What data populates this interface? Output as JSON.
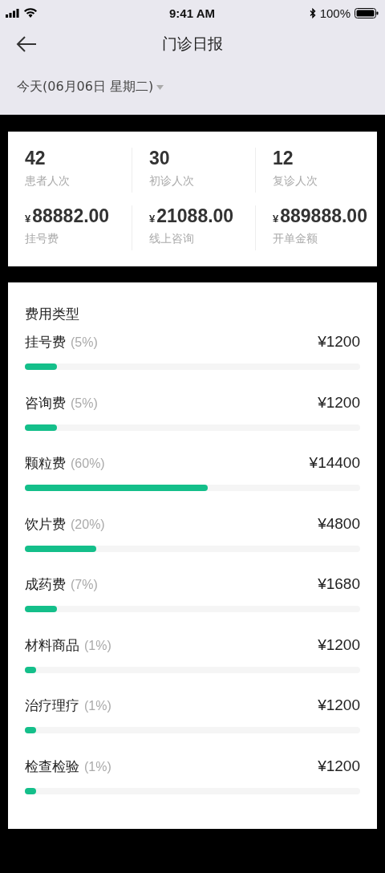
{
  "status_bar": {
    "time": "9:41 AM",
    "battery": "100%"
  },
  "nav": {
    "title": "门诊日报"
  },
  "date_filter": {
    "label": "今天(06月06日 星期二)"
  },
  "summary": {
    "stats": [
      {
        "value": "42",
        "label": "患者人次"
      },
      {
        "value": "30",
        "label": "初诊人次"
      },
      {
        "value": "12",
        "label": "复诊人次"
      },
      {
        "currency": "¥",
        "value": "88882.00",
        "label": "挂号费"
      },
      {
        "currency": "¥",
        "value": "21088.00",
        "label": "线上咨询"
      },
      {
        "currency": "¥",
        "value": "889888.00",
        "label": "开单金额"
      }
    ]
  },
  "fee_types": {
    "title": "费用类型",
    "items": [
      {
        "name": "挂号费",
        "percent": "(5%)",
        "amount": "¥1200",
        "level": 0.095
      },
      {
        "name": "咨询费",
        "percent": "(5%)",
        "amount": "¥1200",
        "level": 0.095
      },
      {
        "name": "颗粒费",
        "percent": "(60%)",
        "amount": "¥14400",
        "level": 0.545
      },
      {
        "name": "饮片费",
        "percent": "(20%)",
        "amount": "¥4800",
        "level": 0.213
      },
      {
        "name": "成药费",
        "percent": "(7%)",
        "amount": "¥1680",
        "level": 0.095
      },
      {
        "name": "材料商品",
        "percent": "(1%)",
        "amount": "¥1200",
        "level": 0.033
      },
      {
        "name": "治疗理疗",
        "percent": "(1%)",
        "amount": "¥1200",
        "level": 0.033
      },
      {
        "name": "检查检验",
        "percent": "(1%)",
        "amount": "¥1200",
        "level": 0.033
      }
    ]
  }
}
